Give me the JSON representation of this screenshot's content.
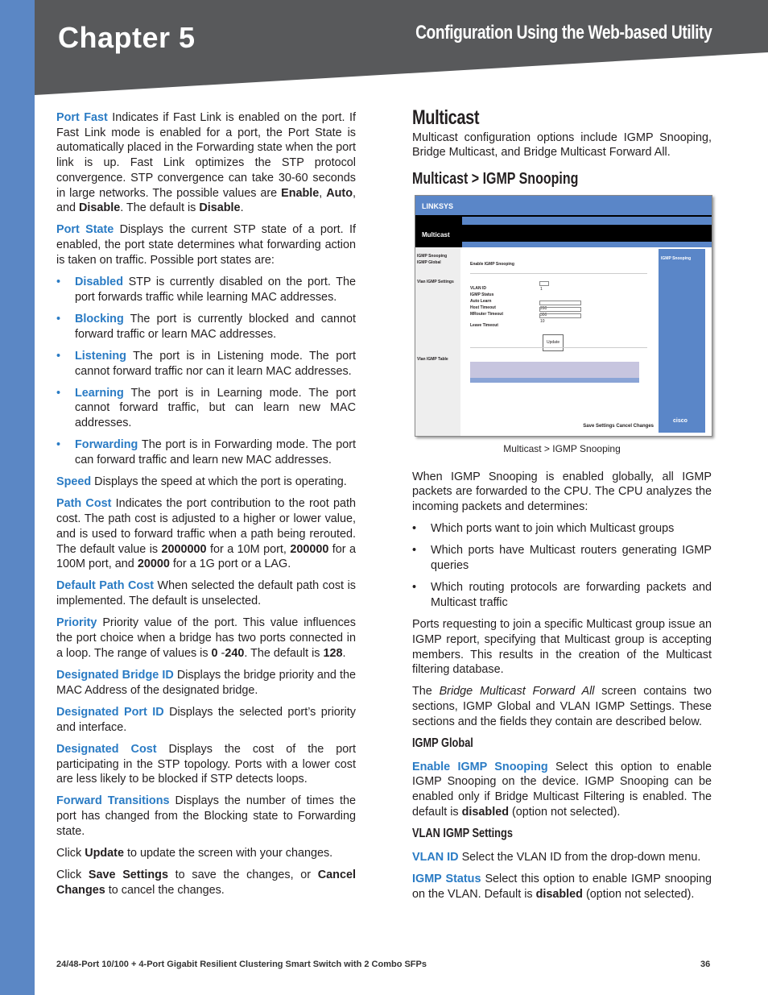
{
  "header": {
    "chapter": "Chapter 5",
    "title": "Configuration Using the Web-based Utility",
    "colors": {
      "strip": "#5b87c5",
      "band": "#58595b",
      "term": "#2a7bc4"
    }
  },
  "left": {
    "blocks": [
      {
        "type": "p",
        "term": "Port Fast",
        "text": [
          [
            "n",
            " Indicates if Fast Link is enabled on the port. If Fast Link mode is enabled for a port, the Port State is automatically placed in the Forwarding state when the port link is up. Fast Link optimizes the STP protocol convergence. STP convergence can take 30-60 seconds in large networks. The possible values are "
          ],
          [
            "b",
            "Enable"
          ],
          [
            "n",
            ", "
          ],
          [
            "b",
            "Auto"
          ],
          [
            "n",
            ", and "
          ],
          [
            "b",
            "Disable"
          ],
          [
            "n",
            ". The default is "
          ],
          [
            "b",
            "Disable"
          ],
          [
            "n",
            "."
          ]
        ]
      },
      {
        "type": "p",
        "term": "Port State",
        "text": [
          [
            "n",
            " Displays the current STP state of a port. If enabled, the port state determines what forwarding action is taken on traffic. Possible port states are:"
          ]
        ]
      },
      {
        "type": "li",
        "term": "Disabled",
        "text": [
          [
            "n",
            " STP is currently disabled on the port. The port forwards traffic while learning MAC addresses."
          ]
        ]
      },
      {
        "type": "li",
        "term": "Blocking",
        "text": [
          [
            "n",
            " The port is currently blocked and cannot forward traffic or learn MAC addresses."
          ]
        ]
      },
      {
        "type": "li",
        "term": "Listening",
        "text": [
          [
            "n",
            " The port is in Listening mode. The port cannot forward traffic nor can it learn MAC addresses."
          ]
        ]
      },
      {
        "type": "li",
        "term": "Learning",
        "text": [
          [
            "n",
            " The port is in Learning mode. The port cannot forward traffic, but can learn new MAC addresses."
          ]
        ]
      },
      {
        "type": "li",
        "term": "Forwarding",
        "text": [
          [
            "n",
            " The port is in Forwarding mode. The port can forward traffic and learn new MAC addresses."
          ]
        ]
      },
      {
        "type": "p",
        "term": "Speed",
        "text": [
          [
            "n",
            " Displays the speed at which the port is operating."
          ]
        ]
      },
      {
        "type": "p",
        "term": "Path Cost",
        "text": [
          [
            "n",
            " Indicates the port contribution to the root path cost. The path cost is adjusted to a higher or lower value, and is used to forward traffic when a path being rerouted. The default value is "
          ],
          [
            "b",
            "2000000"
          ],
          [
            "n",
            " for a 10M port, "
          ],
          [
            "b",
            "200000"
          ],
          [
            "n",
            " for a 100M port, and "
          ],
          [
            "b",
            "20000"
          ],
          [
            "n",
            " for a 1G port or a LAG."
          ]
        ]
      },
      {
        "type": "p",
        "term": "Default Path Cost",
        "text": [
          [
            "n",
            " When selected the default path cost is implemented. The default is unselected."
          ]
        ]
      },
      {
        "type": "p",
        "term": "Priority",
        "text": [
          [
            "n",
            " Priority value of the port. This value influences the port choice when a bridge has two ports connected in a loop. The range of values is "
          ],
          [
            "b",
            "0"
          ],
          [
            "n",
            " -"
          ],
          [
            "b",
            "240"
          ],
          [
            "n",
            ". The default is "
          ],
          [
            "b",
            "128"
          ],
          [
            "n",
            "."
          ]
        ]
      },
      {
        "type": "p",
        "term": "Designated Bridge ID",
        "text": [
          [
            "n",
            " Displays the bridge priority and the MAC Address of the designated bridge."
          ]
        ]
      },
      {
        "type": "p",
        "term": "Designated Port ID",
        "text": [
          [
            "n",
            " Displays the selected port’s priority and interface."
          ]
        ]
      },
      {
        "type": "p",
        "term": "Designated Cost",
        "text": [
          [
            "n",
            " Displays the cost of the port participating in the STP topology. Ports with a lower cost are less likely to be blocked if STP detects loops."
          ]
        ]
      },
      {
        "type": "p",
        "term": "Forward Transitions",
        "text": [
          [
            "n",
            " Displays the number of times the port has changed from the Blocking state to Forwarding state."
          ]
        ]
      },
      {
        "type": "p",
        "term": "",
        "text": [
          [
            "n",
            "Click "
          ],
          [
            "b",
            "Update"
          ],
          [
            "n",
            " to update the screen with your changes."
          ]
        ]
      },
      {
        "type": "p",
        "term": "",
        "text": [
          [
            "n",
            "Click "
          ],
          [
            "b",
            "Save Settings"
          ],
          [
            "n",
            " to save the changes, or "
          ],
          [
            "b",
            "Cancel Changes"
          ],
          [
            "n",
            " to cancel the changes."
          ]
        ]
      }
    ]
  },
  "right": {
    "heading": "Multicast",
    "intro": "Multicast configuration options include IGMP Snooping, Bridge Multicast, and Bridge Multicast Forward All.",
    "subheading": "Multicast > IGMP Snooping",
    "screenshot": {
      "logo": "LINKSYS",
      "section": "Multicast",
      "nav": [
        "Setup",
        "Port Management",
        "VLAN Management",
        "Statistics",
        "Security",
        "QoS",
        "Spanning Tree",
        "Multicast",
        "SNMP",
        "Admin",
        "LogOut"
      ],
      "side": [
        "IGMP Snooping",
        "IGMP Global",
        "Vlan IGMP Settings",
        "Vlan IGMP Table"
      ],
      "fields": [
        "Enable IGMP Snooping",
        "VLAN ID",
        "IGMP Status",
        "Auto Learn",
        "Host Timeout",
        "MRouter Timeout",
        "Leave Timeout"
      ],
      "values": [
        "1",
        "260",
        "300",
        "10"
      ],
      "update": "Update",
      "save": "Save Settings",
      "cancel": "Cancel Changes",
      "help_title": "IGMP Snooping",
      "brand": "cisco"
    },
    "caption": "Multicast > IGMP Snooping",
    "blocks": [
      {
        "type": "p",
        "term": "",
        "text": [
          [
            "n",
            "When IGMP Snooping is enabled globally, all IGMP packets are forwarded to the CPU. The CPU analyzes the incoming packets and determines:"
          ]
        ]
      },
      {
        "type": "li",
        "term": "",
        "text": [
          [
            "n",
            "Which ports want to join which Multicast groups"
          ]
        ]
      },
      {
        "type": "li",
        "term": "",
        "text": [
          [
            "n",
            "Which ports have Multicast routers generating IGMP queries"
          ]
        ]
      },
      {
        "type": "li",
        "term": "",
        "text": [
          [
            "n",
            "Which routing protocols are forwarding packets and Multicast traffic"
          ]
        ]
      },
      {
        "type": "p",
        "term": "",
        "text": [
          [
            "n",
            "Ports requesting to join a specific Multicast group issue an IGMP report, specifying that Multicast group is accepting members. This results in the creation of the Multicast filtering database."
          ]
        ]
      },
      {
        "type": "p",
        "term": "",
        "text": [
          [
            "n",
            "The "
          ],
          [
            "i",
            "Bridge Multicast Forward All"
          ],
          [
            "n",
            " screen contains two sections, IGMP Global and VLAN IGMP Settings. These sections and the fields they contain are described below."
          ]
        ]
      },
      {
        "type": "h4",
        "term": "",
        "text": [
          [
            "n",
            "IGMP Global"
          ]
        ]
      },
      {
        "type": "p",
        "term": "Enable IGMP Snooping",
        "text": [
          [
            "n",
            " Select this option to enable IGMP Snooping on the device. IGMP Snooping can be enabled only if Bridge Multicast Filtering is enabled. The default is "
          ],
          [
            "b",
            "disabled"
          ],
          [
            "n",
            " (option not selected)."
          ]
        ]
      },
      {
        "type": "h4",
        "term": "",
        "text": [
          [
            "n",
            "VLAN IGMP Settings"
          ]
        ]
      },
      {
        "type": "p",
        "term": "VLAN ID",
        "text": [
          [
            "n",
            " Select the VLAN ID from the drop-down menu."
          ]
        ]
      },
      {
        "type": "p",
        "term": "IGMP Status",
        "text": [
          [
            "n",
            " Select this option to enable IGMP snooping on the VLAN. Default is "
          ],
          [
            "b",
            "disabled"
          ],
          [
            "n",
            " (option not selected)."
          ]
        ]
      }
    ]
  },
  "footer": {
    "product": "24/48-Port 10/100 + 4-Port Gigabit Resilient Clustering Smart Switch with 2 Combo SFPs",
    "page": "36"
  }
}
